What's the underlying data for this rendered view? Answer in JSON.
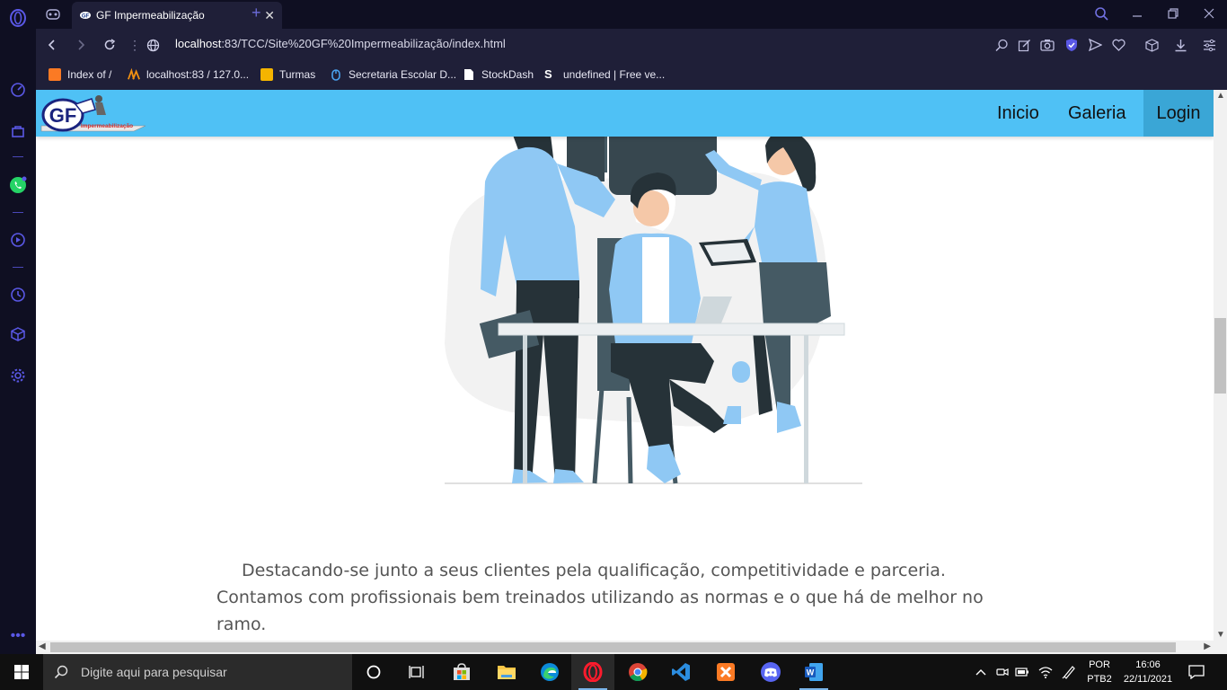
{
  "browser": {
    "tab_title": "GF Impermeabilização",
    "url_host": "localhost",
    "url_rest": ":83/TCC/Site%20GF%20Impermeabilização/index.html",
    "bookmarks": [
      {
        "label": "Index of /"
      },
      {
        "label": "localhost:83 / 127.0..."
      },
      {
        "label": "Turmas"
      },
      {
        "label": "Secretaria Escolar D..."
      },
      {
        "label": "StockDash"
      },
      {
        "label": "undefined | Free ve..."
      }
    ]
  },
  "site": {
    "logo_text": "GF",
    "logo_sub": "Impermeabilização",
    "nav": [
      {
        "label": "Inicio"
      },
      {
        "label": "Galeria"
      },
      {
        "label": "Login"
      }
    ],
    "paragraph": "Destacando-se junto a seus clientes pela qualificação, competitividade e parceria. Contamos com profissionais bem treinados utilizando as normas e o que há de melhor no ramo."
  },
  "taskbar": {
    "search_placeholder": "Digite aqui para pesquisar",
    "lang_top": "POR",
    "lang_bottom": "PTB2",
    "time": "16:06",
    "date": "22/11/2021"
  },
  "colors": {
    "nav_bg": "#4fc1f5",
    "nav_active": "#3aa6d6",
    "illustration_blue": "#8fc8f4",
    "opera_accent": "#5a58e6"
  }
}
